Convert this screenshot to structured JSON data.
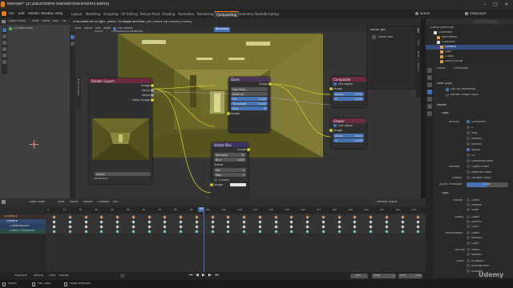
{
  "window": {
    "title": "Blender* [E:\\Backrooms Blender\\Backrooms.blend]"
  },
  "menu": [
    "File",
    "Edit",
    "Render",
    "Window",
    "Help"
  ],
  "workspaces": [
    "Layout",
    "Modeling",
    "Sculpting",
    "UV Editing",
    "Texture Paint",
    "Shading",
    "Animation",
    "Rendering",
    "Compositing",
    "Geometry Nodes",
    "Scripting"
  ],
  "active_workspace": "Compositing",
  "scene": "Scene",
  "view_layer": "ViewLayer",
  "viewport": {
    "mode": "Object Mode",
    "menus": [
      "View",
      "Select",
      "Add",
      "Ob"
    ],
    "overlay_label": "Scripted Keys"
  },
  "node_editor": {
    "info": "Auto-offset set to right - press T to toggle direction | Dv: 0.0000 Dy: 0.0000 (0.0000)",
    "header_menus": [
      "View",
      "Select",
      "Add",
      "Node"
    ],
    "use_nodes": "Use Nodes",
    "backdrop": "Backdrop",
    "breadcrumb": [
      "Scene",
      "Compositing Nodetree"
    ],
    "side_label": "Node Wrangler"
  },
  "nodes": {
    "render_layers": {
      "title": "Render Layers",
      "outputs": [
        "Image",
        "Alpha",
        "Denoi",
        "Noisy Image"
      ],
      "scene": "Scene",
      "layer": "ViewLayer"
    },
    "glare": {
      "title": "Glare",
      "output": "Image",
      "type": "Fog Glow",
      "quality": "Medium",
      "fields": [
        {
          "label": "Mix",
          "value": "0.000"
        },
        {
          "label": "Threshold",
          "value": "0.000"
        },
        {
          "label": "Size",
          "value": "8"
        }
      ],
      "input": "Image"
    },
    "composite": {
      "title": "Composite",
      "use_alpha": "Use Alpha",
      "input": "Image",
      "alpha_label": "Alpha",
      "alpha_value": "1.000",
      "z_label": "Z",
      "z_value": "1.000"
    },
    "viewer": {
      "title": "Viewer",
      "use_alpha": "Use Alpha",
      "input": "Image",
      "alpha_label": "Alpha",
      "alpha_value": "1.000",
      "z_label": "Z",
      "z_value": "1.000"
    },
    "vector_blur": {
      "title": "Vector Blur",
      "output": "Image",
      "fields": [
        {
          "label": "Samples",
          "value": "32"
        },
        {
          "label": "Blur",
          "value": "1.000"
        }
      ],
      "speed_label": "Speed",
      "speed_fields": [
        {
          "label": "Min",
          "value": "0"
        },
        {
          "label": "Max",
          "value": "0"
        }
      ],
      "curved": "Curved",
      "inputs": [
        "Image",
        "Z",
        "Speed"
      ]
    }
  },
  "npanel": {
    "title": "Active Tool",
    "item": "Select Box",
    "tabs": [
      "Tool",
      "View",
      "Node",
      "Options"
    ]
  },
  "outliner": {
    "title": "Scene Collection",
    "items": [
      "Collection",
      "Backrooms",
      "Collection",
      "Camera",
      "Light",
      "Cubes",
      "Lamp.ceiling"
    ]
  },
  "properties": {
    "scene_label": "Scene",
    "layer_label": "ViewLayer",
    "section_view_layer": "View Layer",
    "use_rendering": "Use for Rendering",
    "render_single": "Render Single Layer",
    "section_passes": "Passes",
    "section_data": "Data",
    "include_label": "Include",
    "data_passes": [
      {
        "label": "Combined",
        "on": true
      },
      {
        "label": "Z",
        "on": false
      },
      {
        "label": "Mist",
        "on": false
      },
      {
        "label": "Position",
        "on": false
      },
      {
        "label": "Normal",
        "on": false
      },
      {
        "label": "Vector",
        "on": true
      },
      {
        "label": "UV",
        "on": false
      },
      {
        "label": "Denoising Data",
        "on": false
      }
    ],
    "indexes_label": "Indexes",
    "indexes": [
      "Object Index",
      "Material Index"
    ],
    "debug_label": "Debug",
    "debug": [
      "Sample Count"
    ],
    "alpha_threshold_label": "Alpha Threshold",
    "alpha_threshold_value": "0.500",
    "section_light": "Light",
    "light_groups": [
      {
        "label": "Diffuse",
        "items": [
          "Direct",
          "Indirect",
          "Color"
        ]
      },
      {
        "label": "Glossy",
        "items": [
          "Direct",
          "Indirect",
          "Color"
        ]
      },
      {
        "label": "Transmission",
        "items": [
          "Direct",
          "Indirect",
          "Color"
        ]
      },
      {
        "label": "Volume",
        "items": [
          "Direct",
          "Indirect"
        ]
      },
      {
        "label": "Other",
        "items": [
          "Emission",
          "Environment",
          "Shadow"
        ]
      }
    ]
  },
  "timeline": {
    "editor": "Dope Sheet",
    "menus": [
      "View",
      "Select",
      "Marker",
      "Channel",
      "Key"
    ],
    "mode": "Nearest Frame",
    "ruler": [
      "0",
      "10",
      "20",
      "30",
      "40",
      "50",
      "60",
      "70",
      "80",
      "90",
      "100",
      "110",
      "120",
      "130",
      "140",
      "150",
      "160",
      "170",
      "180",
      "190",
      "200",
      "210",
      "220",
      "230"
    ],
    "channels": [
      "Summary",
      "Camera",
      "CameraAction",
      "Object Transforms"
    ],
    "current_frame": "90"
  },
  "playback": {
    "playback": "Playback",
    "keying": "Keying",
    "view": "View",
    "marker": "Marker",
    "frame": "100",
    "start_label": "Start",
    "start": "1",
    "end_label": "End",
    "end": "250"
  },
  "status": {
    "left": "Select",
    "mid": "Pan View",
    "right": "Node Wrangler"
  },
  "colors": {
    "accent": "#ff7f2a",
    "selected": "#4772b3",
    "socket_image": "#c7c729",
    "socket_value": "#a1a1a1",
    "render_header": "#6b2a3f",
    "filter_header": "#4a3559",
    "vector_header": "#3b3464"
  },
  "watermark": "Udemy"
}
